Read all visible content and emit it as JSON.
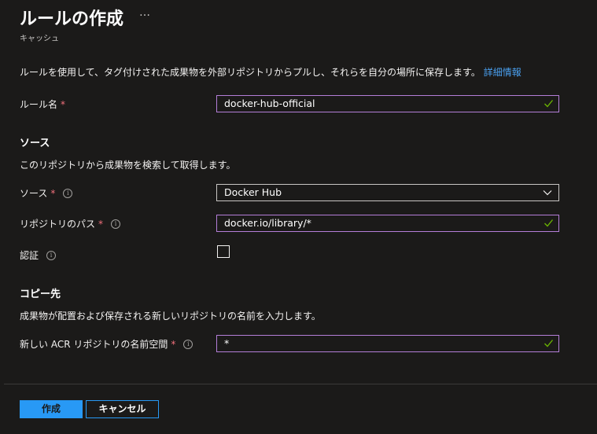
{
  "header": {
    "title": "ルールの作成",
    "more_label": "…",
    "subtitle": "キャッシュ"
  },
  "description": {
    "text": "ルールを使用して、タグ付けされた成果物を外部リポジトリからプルし、それらを自分の場所に保存します。",
    "link": "詳細情報"
  },
  "rule_name": {
    "label": "ルール名",
    "required": "*",
    "value": "docker-hub-official"
  },
  "source_section": {
    "heading": "ソース",
    "description": "このリポジトリから成果物を検索して取得します。",
    "source_label": "ソース",
    "source_required": "*",
    "source_value": "Docker Hub",
    "repo_path_label": "リポジトリのパス",
    "repo_path_required": "*",
    "repo_path_value": "docker.io/library/*",
    "auth_label": "認証",
    "auth_checked": false
  },
  "destination_section": {
    "heading": "コピー先",
    "description": "成果物が配置および保存される新しいリポジトリの名前を入力します。",
    "namespace_label": "新しい ACR リポジトリの名前空間",
    "namespace_required": "*",
    "namespace_value": "*"
  },
  "footer": {
    "create_label": "作成",
    "cancel_label": "キャンセル"
  },
  "colors": {
    "background": "#1b1a19",
    "accent": "#2899f5",
    "input_focus_border": "#b47ed8",
    "required": "#f1707b",
    "link": "#4aa0f0",
    "valid_check": "#6bb700"
  }
}
